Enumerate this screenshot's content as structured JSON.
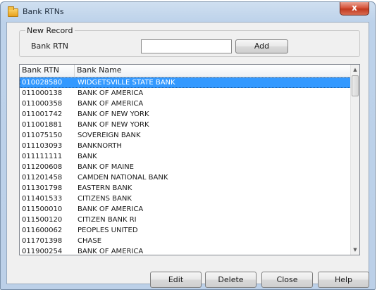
{
  "window": {
    "title": "Bank RTNs",
    "close_label": "x"
  },
  "new_record": {
    "legend": "New Record",
    "field_label": "Bank RTN",
    "input_value": "",
    "add_label": "Add"
  },
  "list": {
    "columns": [
      "Bank RTN",
      "Bank Name"
    ],
    "rows": [
      {
        "rtn": "010028580",
        "name": "WIDGETSVILLE STATE BANK"
      },
      {
        "rtn": "011000138",
        "name": "BANK OF AMERICA"
      },
      {
        "rtn": "011000358",
        "name": "BANK OF AMERICA"
      },
      {
        "rtn": "011001742",
        "name": "BANK OF NEW YORK"
      },
      {
        "rtn": "011001881",
        "name": "BANK OF NEW YORK"
      },
      {
        "rtn": "011075150",
        "name": "SOVEREIGN BANK"
      },
      {
        "rtn": "011103093",
        "name": "BANKNORTH"
      },
      {
        "rtn": "011111111",
        "name": "BANK"
      },
      {
        "rtn": "011200608",
        "name": "BANK OF MAINE"
      },
      {
        "rtn": "011201458",
        "name": "CAMDEN NATIONAL BANK"
      },
      {
        "rtn": "011301798",
        "name": "EASTERN BANK"
      },
      {
        "rtn": "011401533",
        "name": "CITIZENS BANK"
      },
      {
        "rtn": "011500010",
        "name": "BANK OF AMERICA"
      },
      {
        "rtn": "011500120",
        "name": "CITIZEN BANK RI"
      },
      {
        "rtn": "011600062",
        "name": "PEOPLES UNITED"
      },
      {
        "rtn": "011701398",
        "name": "CHASE"
      },
      {
        "rtn": "011900254",
        "name": "BANK OF AMERICA"
      }
    ],
    "selected_index": 0
  },
  "buttons": {
    "edit": "Edit",
    "delete": "Delete",
    "close": "Close",
    "help": "Help"
  },
  "colors": {
    "selection": "#3399ff",
    "close_button": "#c13a20"
  }
}
